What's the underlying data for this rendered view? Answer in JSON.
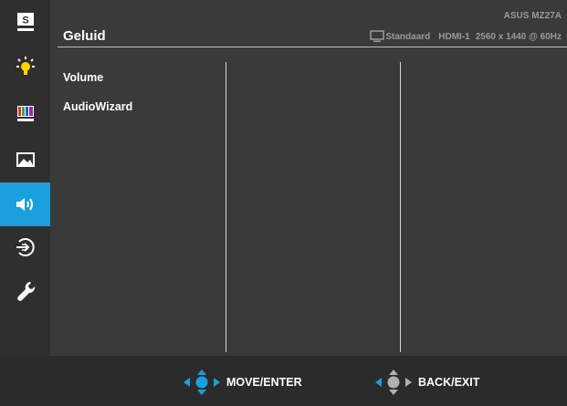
{
  "header": {
    "title": "Geluid",
    "model": "ASUS MZ27A",
    "status": {
      "mode": "Standaard",
      "input": "HDMI-1",
      "resolution": "2560 x 1440 @ 60Hz"
    }
  },
  "sidebar": {
    "items": [
      {
        "name": "splendid",
        "icon": "splendid-s-icon"
      },
      {
        "name": "blue-light-filter",
        "icon": "brightness-icon"
      },
      {
        "name": "color",
        "icon": "color-bars-icon"
      },
      {
        "name": "image",
        "icon": "image-icon"
      },
      {
        "name": "sound",
        "icon": "speaker-icon",
        "active": true
      },
      {
        "name": "input-select",
        "icon": "input-arrow-icon"
      },
      {
        "name": "system-setup",
        "icon": "wrench-icon"
      }
    ]
  },
  "menu": {
    "items": [
      {
        "label": "Volume"
      },
      {
        "label": "AudioWizard"
      }
    ]
  },
  "footer": {
    "move_enter": "MOVE/ENTER",
    "back_exit": "BACK/EXIT"
  },
  "colors": {
    "accent": "#1a9fdc",
    "panel": "#3a3a3a",
    "sidebar": "#2f2f2f"
  }
}
